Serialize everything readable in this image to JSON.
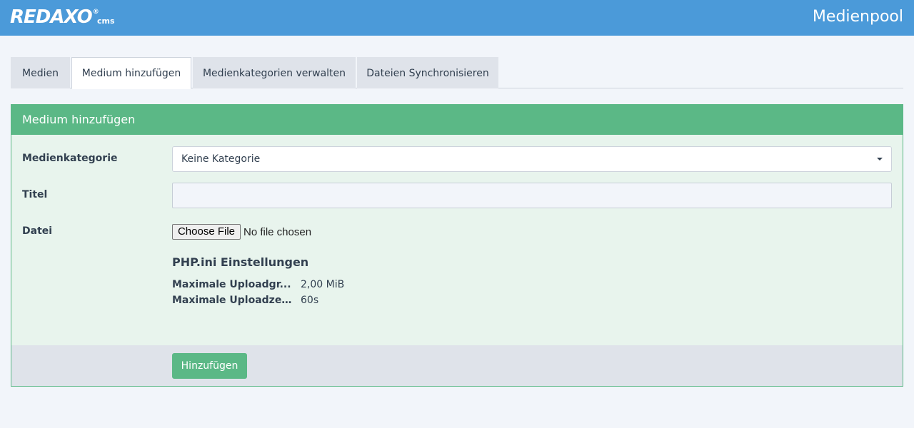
{
  "header": {
    "logo": {
      "part1": "RED",
      "part2": "AXO",
      "reg": "®",
      "suffix": "cms"
    },
    "page_title": "Medienpool"
  },
  "tabs": [
    {
      "label": "Medien",
      "active": false
    },
    {
      "label": "Medium hinzufügen",
      "active": true
    },
    {
      "label": "Medienkategorien verwalten",
      "active": false
    },
    {
      "label": "Dateien Synchronisieren",
      "active": false
    }
  ],
  "panel": {
    "title": "Medium hinzufügen",
    "fields": {
      "category_label": "Medienkategorie",
      "category_value": "Keine Kategorie",
      "title_label": "Titel",
      "title_value": "",
      "file_label": "Datei",
      "file_button": "Choose File",
      "file_status": "No file chosen"
    },
    "php_ini": {
      "heading": "PHP.ini Einstellungen",
      "rows": [
        {
          "key": "Maximale Uploadgr...",
          "value": "2,00 MiB"
        },
        {
          "key": "Maximale Uploadzeit:",
          "value": "60s"
        }
      ]
    },
    "submit_label": "Hinzufügen"
  },
  "colors": {
    "header_bg": "#4b9ad9",
    "accent_green": "#5bb886",
    "panel_bg": "#e8f4ed",
    "page_bg": "#f2f5fa"
  }
}
